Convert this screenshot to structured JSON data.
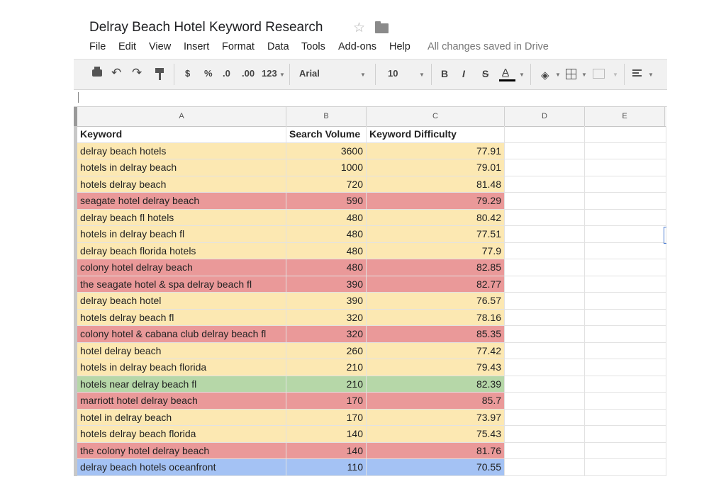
{
  "document": {
    "title": "Delray Beach Hotel Keyword Research",
    "star_icon": "star-icon",
    "folder_icon": "folder-icon"
  },
  "menu": {
    "items": [
      "File",
      "Edit",
      "View",
      "Insert",
      "Format",
      "Data",
      "Tools",
      "Add-ons",
      "Help"
    ],
    "save_status": "All changes saved in Drive"
  },
  "toolbar": {
    "currency": "$",
    "percent": "%",
    "decrease_decimals": ".0",
    "increase_decimals": ".00",
    "more_formats": "123",
    "font": "Arial",
    "font_size": "10",
    "bold": "B",
    "italic": "I",
    "strikethrough": "S",
    "text_color": "A"
  },
  "sheet": {
    "column_headers": [
      "A",
      "B",
      "C",
      "D",
      "E"
    ],
    "header_row": [
      "Keyword",
      "Search Volume",
      "Keyword Difficulty"
    ],
    "rows": [
      {
        "keyword": "delray beach hotels",
        "volume": "3600",
        "difficulty": "77.91",
        "color": "#fce8b2"
      },
      {
        "keyword": "hotels in delray beach",
        "volume": "1000",
        "difficulty": "79.01",
        "color": "#fce8b2"
      },
      {
        "keyword": "hotels delray beach",
        "volume": "720",
        "difficulty": "81.48",
        "color": "#fce8b2"
      },
      {
        "keyword": "seagate hotel delray beach",
        "volume": "590",
        "difficulty": "79.29",
        "color": "#ea9999"
      },
      {
        "keyword": "delray beach fl hotels",
        "volume": "480",
        "difficulty": "80.42",
        "color": "#fce8b2"
      },
      {
        "keyword": "hotels in delray beach fl",
        "volume": "480",
        "difficulty": "77.51",
        "color": "#fce8b2"
      },
      {
        "keyword": "delray beach florida hotels",
        "volume": "480",
        "difficulty": "77.9",
        "color": "#fce8b2"
      },
      {
        "keyword": "colony hotel delray beach",
        "volume": "480",
        "difficulty": "82.85",
        "color": "#ea9999"
      },
      {
        "keyword": "the seagate hotel & spa delray beach fl",
        "volume": "390",
        "difficulty": "82.77",
        "color": "#ea9999"
      },
      {
        "keyword": "delray beach hotel",
        "volume": "390",
        "difficulty": "76.57",
        "color": "#fce8b2"
      },
      {
        "keyword": "hotels delray beach fl",
        "volume": "320",
        "difficulty": "78.16",
        "color": "#fce8b2"
      },
      {
        "keyword": "colony hotel & cabana club delray beach fl",
        "volume": "320",
        "difficulty": "85.35",
        "color": "#ea9999"
      },
      {
        "keyword": "hotel delray beach",
        "volume": "260",
        "difficulty": "77.42",
        "color": "#fce8b2"
      },
      {
        "keyword": "hotels in delray beach florida",
        "volume": "210",
        "difficulty": "79.43",
        "color": "#fce8b2"
      },
      {
        "keyword": "hotels near delray beach fl",
        "volume": "210",
        "difficulty": "82.39",
        "color": "#b6d7a8"
      },
      {
        "keyword": "marriott hotel delray beach",
        "volume": "170",
        "difficulty": "85.7",
        "color": "#ea9999"
      },
      {
        "keyword": "hotel in delray beach",
        "volume": "170",
        "difficulty": "73.97",
        "color": "#fce8b2"
      },
      {
        "keyword": "hotels delray beach florida",
        "volume": "140",
        "difficulty": "75.43",
        "color": "#fce8b2"
      },
      {
        "keyword": "the colony hotel delray beach",
        "volume": "140",
        "difficulty": "81.76",
        "color": "#ea9999"
      },
      {
        "keyword": "delray beach hotels oceanfront",
        "volume": "110",
        "difficulty": "70.55",
        "color": "#a4c2f4"
      }
    ]
  }
}
